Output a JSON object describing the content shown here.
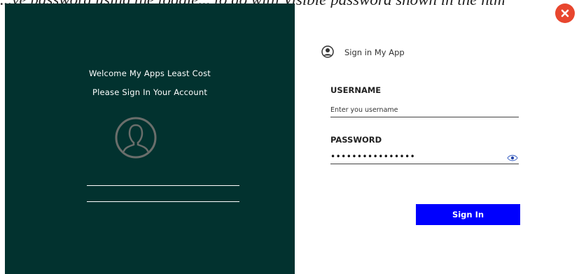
{
  "page": {
    "top_text": "...ve password using the toggle... to do with Visible password shown in the html and with a button that makes the password visible to the user."
  },
  "left_panel": {
    "welcome_line1": "Welcome My Apps Least Cost",
    "welcome_line2": "Please Sign In Your Account",
    "avatar_icon": "user-circle-icon"
  },
  "header": {
    "icon": "user-circle-icon",
    "title": "Sign in My App"
  },
  "form": {
    "username_label": "USERNAME",
    "username_placeholder": "Enter you username",
    "username_value": "",
    "password_label": "PASSWORD",
    "password_value": "••••••••••••••••",
    "eye_icon": "eye-icon",
    "submit_label": "Sign In"
  },
  "close": {
    "icon": "close-icon"
  },
  "colors": {
    "panel_bg": "#02322f",
    "button_bg": "#0000fe",
    "close_bg": "#e8462e"
  }
}
